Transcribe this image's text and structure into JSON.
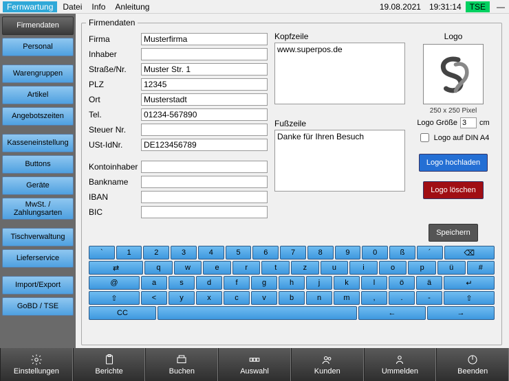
{
  "menubar": {
    "fernwartung": "Fernwartung",
    "datei": "Datei",
    "info": "Info",
    "anleitung": "Anleitung",
    "date": "19.08.2021",
    "time": "19:31:14",
    "tse": "TSE"
  },
  "sidebar": {
    "items": [
      "Firmendaten",
      "Personal",
      "Warengruppen",
      "Artikel",
      "Angebotszeiten",
      "Kasseneinstellung",
      "Buttons",
      "Geräte",
      "MwSt. / Zahlungsarten",
      "Tischverwaltung",
      "Lieferservice",
      "Import/Export",
      "GoBD / TSE"
    ]
  },
  "form": {
    "legend": "Firmendaten",
    "labels": {
      "firma": "Firma",
      "inhaber": "Inhaber",
      "strasse": "Straße/Nr.",
      "plz": "PLZ",
      "ort": "Ort",
      "tel": "Tel.",
      "steuer": "Steuer Nr.",
      "ustid": "USt-IdNr.",
      "kontoinhaber": "Kontoinhaber",
      "bankname": "Bankname",
      "iban": "IBAN",
      "bic": "BIC",
      "kopfzeile": "Kopfzeile",
      "fusszeile": "Fußzeile"
    },
    "values": {
      "firma": "Musterfirma",
      "inhaber": "",
      "strasse": "Muster Str. 1",
      "plz": "12345",
      "ort": "Musterstadt",
      "tel": "01234-567890",
      "steuer": "",
      "ustid": "DE123456789",
      "kontoinhaber": "",
      "bankname": "",
      "iban": "",
      "bic": "",
      "kopfzeile": "www.superpos.de",
      "fusszeile": "Danke für Ihren Besuch"
    },
    "logo": {
      "title": "Logo",
      "dims": "250 x 250 Pixel",
      "size_label": "Logo Größe",
      "size_value": "3",
      "size_unit": "cm",
      "din_a4": "Logo auf DIN A4",
      "upload": "Logo hochladen",
      "delete": "Logo löschen",
      "save": "Speichern"
    }
  },
  "keyboard": {
    "row1": [
      "`",
      "1",
      "2",
      "3",
      "4",
      "5",
      "6",
      "7",
      "8",
      "9",
      "0",
      "ß",
      "´",
      "⌫"
    ],
    "row2": [
      "⇄",
      "q",
      "w",
      "e",
      "r",
      "t",
      "z",
      "u",
      "i",
      "o",
      "p",
      "ü",
      "#"
    ],
    "row3": [
      "@",
      "a",
      "s",
      "d",
      "f",
      "g",
      "h",
      "j",
      "k",
      "l",
      "ö",
      "ä",
      "↵"
    ],
    "row4": [
      "⇧",
      "<",
      "y",
      "x",
      "c",
      "v",
      "b",
      "n",
      "m",
      ",",
      ".",
      "-",
      "⇧"
    ],
    "row5": [
      "CC",
      " ",
      "←",
      "→"
    ]
  },
  "bottom": {
    "items": [
      "Einstellungen",
      "Berichte",
      "Buchen",
      "Auswahl",
      "Kunden",
      "Ummelden",
      "Beenden"
    ]
  }
}
